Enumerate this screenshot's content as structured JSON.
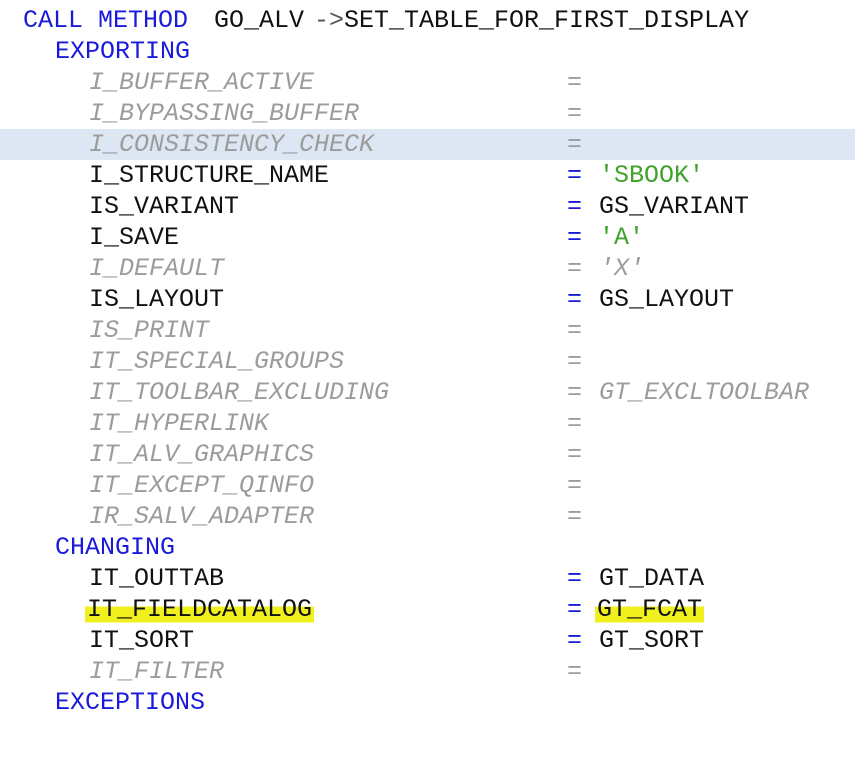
{
  "call": {
    "keyword": "CALL METHOD",
    "object": "GO_ALV",
    "arrow": "->",
    "method": "SET_TABLE_FOR_FIRST_DISPLAY"
  },
  "sections": {
    "exporting": "EXPORTING",
    "changing": "CHANGING",
    "exceptions": "EXCEPTIONS"
  },
  "equals": "=",
  "exporting_params": [
    {
      "name": "I_BUFFER_ACTIVE",
      "value": "",
      "commented": true
    },
    {
      "name": "I_BYPASSING_BUFFER",
      "value": "",
      "commented": true
    },
    {
      "name": "I_CONSISTENCY_CHECK",
      "value": "",
      "commented": true
    },
    {
      "name": "I_STRUCTURE_NAME",
      "value": "'SBOOK'",
      "commented": false
    },
    {
      "name": "IS_VARIANT",
      "value": "GS_VARIANT",
      "commented": false
    },
    {
      "name": "I_SAVE",
      "value": "'A'",
      "commented": false
    },
    {
      "name": "I_DEFAULT",
      "value": "'X'",
      "commented": true
    },
    {
      "name": "IS_LAYOUT",
      "value": "GS_LAYOUT",
      "commented": false
    },
    {
      "name": "IS_PRINT",
      "value": "",
      "commented": true
    },
    {
      "name": "IT_SPECIAL_GROUPS",
      "value": "",
      "commented": true
    },
    {
      "name": "IT_TOOLBAR_EXCLUDING",
      "value": "GT_EXCLTOOLBAR",
      "commented": true
    },
    {
      "name": "IT_HYPERLINK",
      "value": "",
      "commented": true
    },
    {
      "name": "IT_ALV_GRAPHICS",
      "value": "",
      "commented": true
    },
    {
      "name": "IT_EXCEPT_QINFO",
      "value": "",
      "commented": true
    },
    {
      "name": "IR_SALV_ADAPTER",
      "value": "",
      "commented": true
    }
  ],
  "changing_params": [
    {
      "name": "IT_OUTTAB",
      "value": "GT_DATA",
      "commented": false
    },
    {
      "name": "IT_FIELDCATALOG",
      "value": "GT_FCAT",
      "commented": false
    },
    {
      "name": "IT_SORT",
      "value": "GT_SORT",
      "commented": false
    },
    {
      "name": "IT_FILTER",
      "value": "",
      "commented": true
    }
  ],
  "colors": {
    "keyword": "#1a1adb",
    "identifier": "#111111",
    "string_literal": "#3fa32a",
    "comment": "#9c9c9c",
    "current_line": "#dde6f3",
    "highlight": "#f0f01e"
  }
}
